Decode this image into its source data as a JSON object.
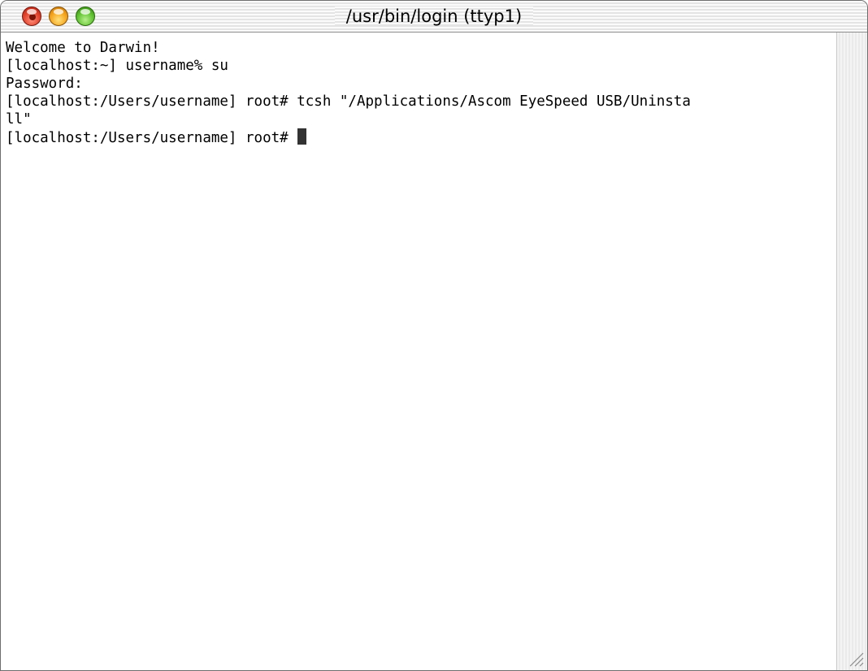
{
  "window": {
    "title": "/usr/bin/login  (ttyp1)"
  },
  "terminal": {
    "lines": [
      "Welcome to Darwin!",
      "[localhost:~] username% su",
      "Password:",
      "[localhost:/Users/username] root# tcsh \"/Applications/Ascom EyeSpeed USB/Uninsta",
      "ll\"",
      "[localhost:/Users/username] root# "
    ]
  },
  "icons": {
    "close": "close-icon",
    "minimize": "minimize-icon",
    "zoom": "zoom-icon",
    "resize": "resize-grip-icon"
  },
  "colors": {
    "close": "#e0402a",
    "minimize": "#f4a21a",
    "zoom": "#5cbf2e",
    "cursor": "#333333"
  }
}
